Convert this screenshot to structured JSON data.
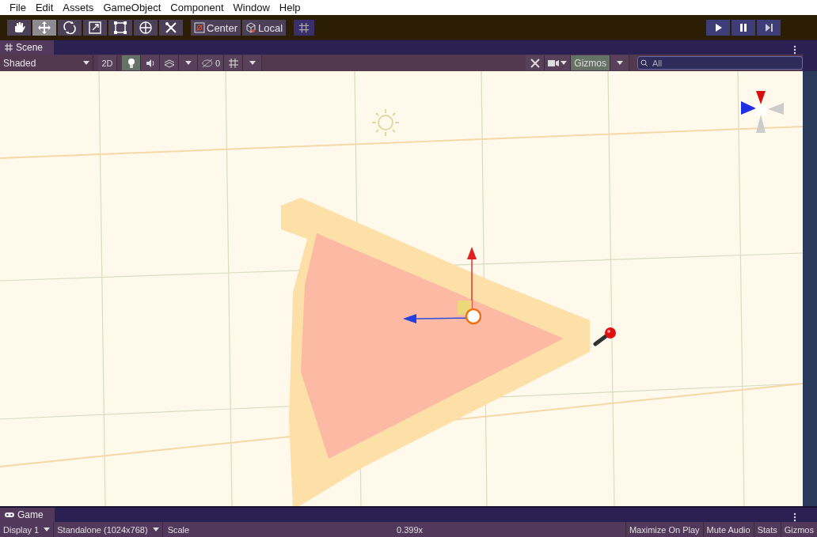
{
  "menu_bar": {
    "items": [
      "File",
      "Edit",
      "Assets",
      "GameObject",
      "Component",
      "Window",
      "Help"
    ]
  },
  "toolbar": {
    "tools": [
      {
        "kind": "hand",
        "selected": false
      },
      {
        "kind": "move",
        "selected": true
      },
      {
        "kind": "rotate",
        "selected": false
      },
      {
        "kind": "scale",
        "selected": false
      },
      {
        "kind": "rect",
        "selected": false
      },
      {
        "kind": "transform",
        "selected": false
      },
      {
        "kind": "custom",
        "selected": false
      }
    ],
    "pivot_buttons": [
      {
        "kind": "pivot",
        "label": "Center"
      },
      {
        "kind": "space",
        "label": "Local"
      }
    ],
    "play_controls": [
      {
        "kind": "play",
        "selected": false
      },
      {
        "kind": "pause",
        "selected": false
      },
      {
        "kind": "step",
        "selected": false
      }
    ]
  },
  "scene_tab": {
    "title": "Scene"
  },
  "scene_toolbar": {
    "draw_mode": "Shaded",
    "mode_2d": {
      "label": "2D",
      "selected": false
    },
    "toggles": [
      {
        "kind": "lighting",
        "selected": true
      },
      {
        "kind": "audio",
        "selected": false
      },
      {
        "kind": "effects",
        "selected": false
      }
    ],
    "hidden_count": "0",
    "gizmos": {
      "label": "Gizmos",
      "selected": true
    },
    "search": {
      "placeholder": "All"
    }
  },
  "game_tab": {
    "title": "Game"
  },
  "game_toolbar": {
    "display": "Display 1",
    "resolution": "Standalone (1024x768)",
    "scale_label": "Scale",
    "scale_value": "0.399x",
    "toggles": [
      {
        "label": "Maximize On Play",
        "selected": false
      },
      {
        "label": "Mute Audio",
        "selected": false
      },
      {
        "label": "Stats",
        "selected": false
      },
      {
        "label": "Gizmos",
        "selected": false
      }
    ]
  }
}
